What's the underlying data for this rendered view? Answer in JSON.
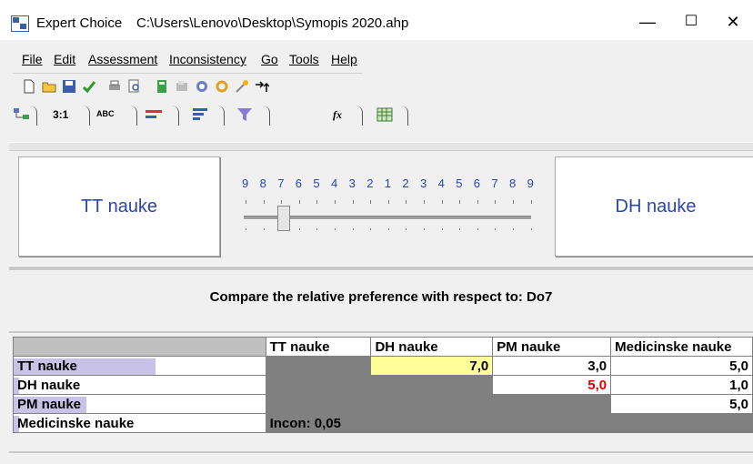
{
  "window": {
    "app_name": "Expert Choice",
    "file_path": "C:\\Users\\Lenovo\\Desktop\\Symopis 2020.ahp",
    "minimize": "—",
    "maximize": "☐",
    "close": "✕"
  },
  "menu": [
    "File",
    "Edit",
    "Assessment",
    "Inconsistency",
    "Go",
    "Tools",
    "Help"
  ],
  "tabs": {
    "ratio": "3:1",
    "abc": "ABC",
    "fx": "fx"
  },
  "comparison": {
    "left": "TT nauke",
    "right": "DH nauke",
    "scale": [
      "9",
      "8",
      "7",
      "6",
      "5",
      "4",
      "3",
      "2",
      "1",
      "2",
      "3",
      "4",
      "5",
      "6",
      "7",
      "8",
      "9"
    ],
    "slider_value": 7,
    "instruction": "Compare the relative preference with respect to: Do7"
  },
  "matrix": {
    "columns": [
      "TT nauke",
      "DH nauke",
      "PM nauke",
      "Medicinske nauke"
    ],
    "rows": [
      {
        "label": "TT nauke",
        "values": [
          "",
          "7,0",
          "3,0",
          "5,0"
        ],
        "bar_fraction": 0.6
      },
      {
        "label": "DH nauke",
        "values": [
          "",
          "",
          "5,0",
          "1,0"
        ],
        "bar_fraction": 0.05
      },
      {
        "label": "PM nauke",
        "values": [
          "",
          "",
          "",
          "5,0"
        ],
        "bar_fraction": 0.3
      },
      {
        "label": "Medicinske nauke",
        "values": [
          "Incon: 0,05",
          "",
          "",
          ""
        ],
        "bar_fraction": 0.04
      }
    ],
    "highlight_color": "#ffff99",
    "inverse_value_color": "#e00000"
  }
}
